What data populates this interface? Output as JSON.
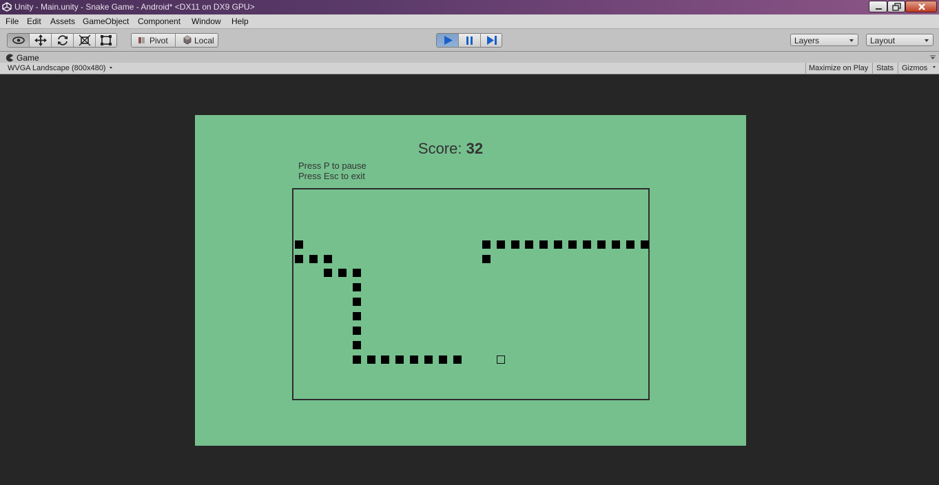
{
  "window": {
    "title": "Unity - Main.unity - Snake Game - Android* <DX11 on DX9 GPU>"
  },
  "menu": [
    "File",
    "Edit",
    "Assets",
    "GameObject",
    "Component",
    "Window",
    "Help"
  ],
  "toolbar": {
    "pivot_label": "Pivot",
    "local_label": "Local",
    "layers_label": "Layers",
    "layout_label": "Layout",
    "play_active": true
  },
  "game_panel": {
    "tab_label": "Game",
    "aspect": "WVGA Landscape (800x480)",
    "maximize_label": "Maximize on Play",
    "stats_label": "Stats",
    "gizmos_label": "Gizmos"
  },
  "game": {
    "score_label": "Score:",
    "score_value": "32",
    "help_pause": "Press P to pause",
    "help_exit": "Press Esc to exit",
    "background_color": "#76c08e",
    "grid": {
      "snake_cells": [
        [
          0,
          4
        ],
        [
          0,
          5
        ],
        [
          1,
          5
        ],
        [
          2,
          5
        ],
        [
          2,
          6
        ],
        [
          3,
          6
        ],
        [
          4,
          6
        ],
        [
          4,
          7
        ],
        [
          4,
          8
        ],
        [
          4,
          9
        ],
        [
          4,
          10
        ],
        [
          4,
          11
        ],
        [
          4,
          12
        ],
        [
          5,
          12
        ],
        [
          6,
          12
        ],
        [
          7,
          12
        ],
        [
          8,
          12
        ],
        [
          9,
          12
        ],
        [
          10,
          12
        ],
        [
          11,
          12
        ],
        [
          13,
          4
        ],
        [
          14,
          4
        ],
        [
          15,
          4
        ],
        [
          16,
          4
        ],
        [
          17,
          4
        ],
        [
          18,
          4
        ],
        [
          19,
          4
        ],
        [
          20,
          4
        ],
        [
          21,
          4
        ],
        [
          22,
          4
        ],
        [
          23,
          4
        ],
        [
          24,
          4
        ],
        [
          13,
          5
        ]
      ],
      "food_cell": [
        14,
        12
      ]
    }
  }
}
